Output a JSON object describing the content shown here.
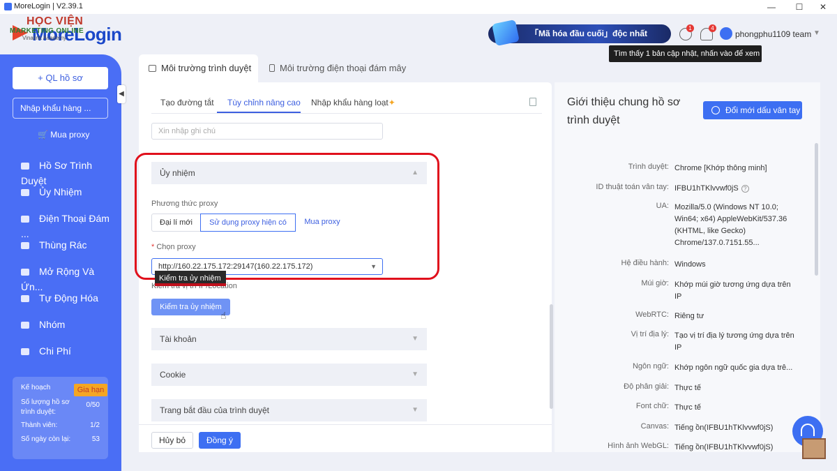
{
  "window": {
    "title": "MoreLogin | V2.39.1",
    "minimize": "—",
    "maximize": "☐",
    "close": "✕"
  },
  "logo": {
    "overlay_line1": "HỌC VIỆN",
    "overlay_line2": "MARKETING ONLINE",
    "brand": "MoreLogin",
    "sub": "Vinalink Academy"
  },
  "header": {
    "promo_text": "「Mã hóa đầu cuối」độc nhất",
    "update_badge": "1",
    "notify_badge": "4",
    "team_name": "phongphu1109 team",
    "update_tooltip": "Tìm thấy 1 bản cập nhật, nhấn vào để xem"
  },
  "sidebar": {
    "new_profile": "+ QL hồ sơ",
    "import": "Nhập khẩu hàng ...",
    "buy_proxy": "Mua proxy",
    "items": [
      {
        "label": "Hồ Sơ Trình Duyệt"
      },
      {
        "label": "Ủy Nhiệm"
      },
      {
        "label": "Điện Thoại Đám ..."
      },
      {
        "label": "Thùng Rác"
      },
      {
        "label": "Mở Rộng Và Ứn..."
      },
      {
        "label": "Tự Động Hóa"
      },
      {
        "label": "Nhóm"
      },
      {
        "label": "Chi Phí"
      }
    ],
    "plan": {
      "label": "Kế hoạch",
      "renew": "Gia hạn",
      "profiles_label": "Số lượng hồ sơ trình duyệt:",
      "profiles_value": "0/50",
      "members_label": "Thành viên:",
      "members_value": "1/2",
      "days_label": "Số ngày còn lại:",
      "days_value": "53"
    }
  },
  "tabs": {
    "browser_env": "Môi trường trình duyệt",
    "cloud_phone_env": "Môi trường điện thoại đám mây"
  },
  "form": {
    "subtabs": {
      "quick": "Tạo đường tắt",
      "advanced": "Tùy chỉnh nâng cao",
      "bulk": "Nhập khẩu hàng loạt"
    },
    "note_placeholder": "Xin nhập ghi chú",
    "proxy_section": "Ủy nhiệm",
    "proxy_method_label": "Phương thức proxy",
    "proxy_methods": {
      "new": "Đại lí mới",
      "existing": "Sử dụng proxy hiện có",
      "buy": "Mua proxy"
    },
    "choose_proxy_label": "Chọn proxy",
    "choose_proxy_value": "http://160.22.175.172:29147(160.22.175.172)",
    "check_tooltip": "Kiểm tra ủy nhiệm",
    "check_note": "Kiểm tra vị trí IP/Location",
    "check_button": "Kiểm tra ủy nhiệm",
    "account_section": "Tài khoản",
    "cookie_section": "Cookie",
    "startpage_section": "Trang bắt đầu của trình duyệt",
    "cancel": "Hủy bỏ",
    "ok": "Đồng ý"
  },
  "overview": {
    "title": "Giới thiệu chung hồ sơ trình duyệt",
    "refresh_button": "Đổi mới dấu vân tay",
    "rows": [
      {
        "key": "Trình duyệt:",
        "value": "Chrome [Khớp thông minh]"
      },
      {
        "key": "ID thuật toán vân tay:",
        "value": "IFBU1hTKlvvwf0jS"
      },
      {
        "key": "UA:",
        "value": "Mozilla/5.0 (Windows NT 10.0; Win64; x64) AppleWebKit/537.36 (KHTML, like Gecko) Chrome/137.0.7151.55..."
      },
      {
        "key": "Hệ điều hành:",
        "value": "Windows"
      },
      {
        "key": "Múi giờ:",
        "value": "Khớp múi giờ tương ứng dựa trên IP"
      },
      {
        "key": "WebRTC:",
        "value": "Riêng tư"
      },
      {
        "key": "Vị trí địa lý:",
        "value": "Tạo vị trí địa lý tương ứng dựa trên IP"
      },
      {
        "key": "Ngôn ngữ:",
        "value": "Khớp ngôn ngữ quốc gia dựa trê..."
      },
      {
        "key": "Độ phân giải:",
        "value": "Thực tế"
      },
      {
        "key": "Font chữ:",
        "value": "Thực tế"
      },
      {
        "key": "Canvas:",
        "value": "Tiếng ồn(IFBU1hTKlvvwf0jS)"
      },
      {
        "key": "Hình ảnh WebGL:",
        "value": "Tiếng ồn(IFBU1hTKlvvwf0jS)"
      }
    ]
  }
}
